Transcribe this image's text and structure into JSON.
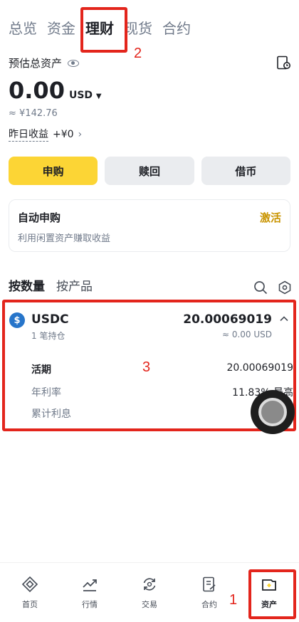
{
  "top_tabs": [
    "总览",
    "资金",
    "理财",
    "现货",
    "合约"
  ],
  "overview": {
    "est_label": "预估总资产",
    "balance": "0.00",
    "currency": "USD",
    "approx": "≈ ¥142.76",
    "yesterday_label": "昨日收益",
    "yesterday_value": "+¥0"
  },
  "actions": {
    "subscribe": "申购",
    "redeem": "赎回",
    "borrow": "借币"
  },
  "auto_subscribe": {
    "title": "自动申购",
    "subtitle": "利用闲置资产赚取收益",
    "action": "激活"
  },
  "list_tabs": {
    "by_amount": "按数量",
    "by_product": "按产品"
  },
  "asset": {
    "coin_glyph": "$",
    "name": "USDC",
    "positions": "1 笔持仓",
    "amount": "20.00069019",
    "usd": "≈ 0.00 USD",
    "rows": [
      {
        "label": "活期",
        "value": "20.00069019"
      },
      {
        "label": "年利率",
        "value": "11.83% 最高"
      },
      {
        "label": "累计利息",
        "value": ""
      }
    ]
  },
  "annotations": {
    "n1": "1",
    "n2": "2",
    "n3": "3"
  },
  "nav": [
    "首页",
    "行情",
    "交易",
    "合约",
    "资产"
  ],
  "colors": {
    "accent_yellow": "#fcd535",
    "activate_text": "#c99400",
    "annotation_red": "#e3251c",
    "usdc_blue": "#2775ca"
  }
}
